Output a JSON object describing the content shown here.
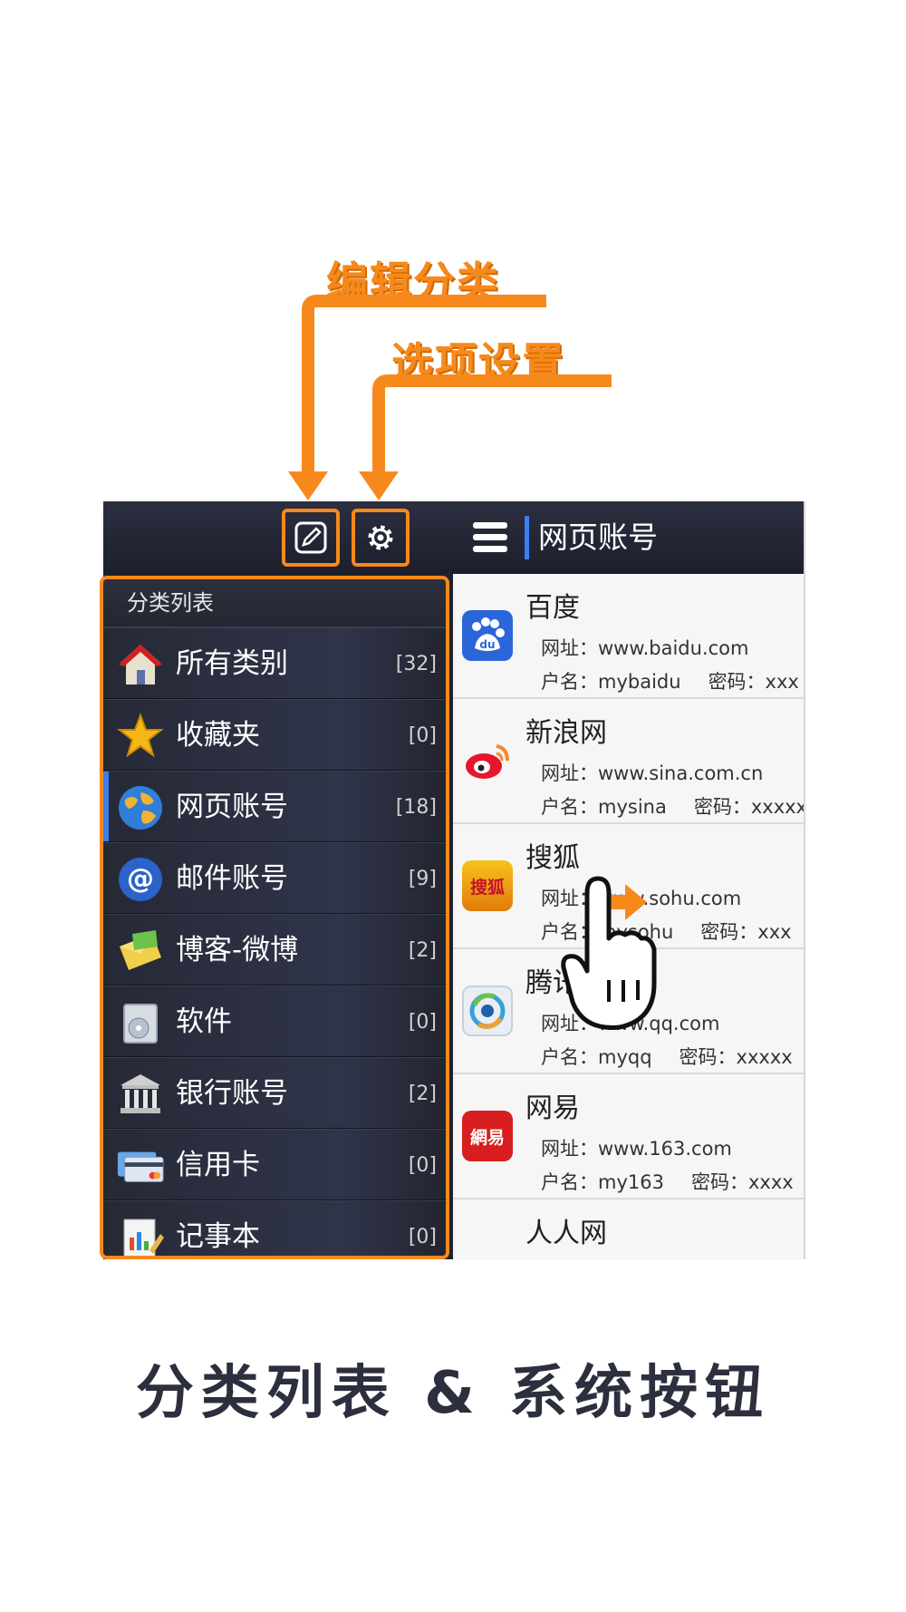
{
  "callouts": {
    "edit": "编辑分类",
    "settings": "选项设置"
  },
  "categories": {
    "header": "分类列表",
    "items": [
      {
        "label": "所有类别",
        "count": "[32]",
        "icon": "house-icon"
      },
      {
        "label": "收藏夹",
        "count": "[0]",
        "icon": "star-icon"
      },
      {
        "label": "网页账号",
        "count": "[18]",
        "icon": "globe-icon"
      },
      {
        "label": "邮件账号",
        "count": "[9]",
        "icon": "at-icon"
      },
      {
        "label": "博客-微博",
        "count": "[2]",
        "icon": "envelope-icon"
      },
      {
        "label": "软件",
        "count": "[0]",
        "icon": "software-icon"
      },
      {
        "label": "银行账号",
        "count": "[2]",
        "icon": "bank-icon"
      },
      {
        "label": "信用卡",
        "count": "[0]",
        "icon": "credit-card-icon"
      },
      {
        "label": "记事本",
        "count": "[0]",
        "icon": "notepad-icon"
      }
    ]
  },
  "right": {
    "title": "网页账号",
    "entries": [
      {
        "name": "百度",
        "url": "网址：www.baidu.com",
        "user": "户名：mybaidu",
        "pwd": "密码：xxx",
        "logo": "du",
        "logo_color": "#2b66d9"
      },
      {
        "name": "新浪网",
        "url": "网址：www.sina.com.cn",
        "user": "户名：mysina",
        "pwd": "密码：xxxxx",
        "logo": "",
        "logo_color": "#e6162d"
      },
      {
        "name": "搜狐",
        "url": "网址：www.sohu.com",
        "user": "户名：mysohu",
        "pwd": "密码：xxx",
        "logo": "搜狐",
        "logo_color": "#f1a800"
      },
      {
        "name": "腾讯",
        "url": "网址：www.qq.com",
        "user": "户名：myqq",
        "pwd": "密码：xxxxx",
        "logo": "",
        "logo_color": "#3aa0d8"
      },
      {
        "name": "网易",
        "url": "网址：www.163.com",
        "user": "户名：my163",
        "pwd": "密码：xxxx",
        "logo": "網易",
        "logo_color": "#d81e1e"
      },
      {
        "name": "人人网",
        "url": "",
        "user": "",
        "pwd": "",
        "logo": "",
        "logo_color": "#f6f6f7"
      }
    ]
  },
  "footer": "分类列表 & 系统按钮",
  "colors": {
    "accent": "#f7891c",
    "active": "#3d7ef0",
    "dark": "#1f2230"
  }
}
